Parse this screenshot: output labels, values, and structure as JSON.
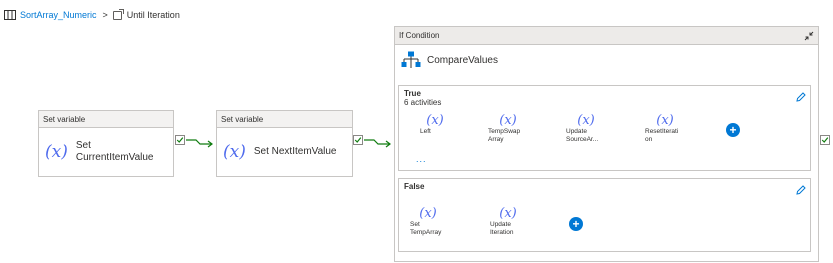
{
  "breadcrumb": {
    "pipeline": "SortArray_Numeric",
    "separator": ">",
    "current": "Until Iteration"
  },
  "activities": [
    {
      "header": "Set variable",
      "label_line1": "Set",
      "label_line2": "CurrentItemValue"
    },
    {
      "header": "Set variable",
      "label": "Set NextItemValue"
    }
  ],
  "if_condition": {
    "header": "If Condition",
    "name": "CompareValues",
    "true_branch": {
      "title": "True",
      "subtitle": "6 activities",
      "items": [
        {
          "l1": "Left",
          "l2": ""
        },
        {
          "l1": "TempSwap",
          "l2": "Array"
        },
        {
          "l1": "Update",
          "l2": "SourceAr..."
        },
        {
          "l1": "ResetIterati",
          "l2": "on"
        }
      ],
      "more": "..."
    },
    "false_branch": {
      "title": "False",
      "items": [
        {
          "l1": "Set",
          "l2": "TempArray"
        },
        {
          "l1": "Update",
          "l2": "Iteration"
        }
      ]
    }
  },
  "icons": {
    "variable": "(x)",
    "plus": "+"
  },
  "colors": {
    "accent": "#0078d4",
    "success": "#107c10",
    "variable_icon": "#4f6bed"
  }
}
